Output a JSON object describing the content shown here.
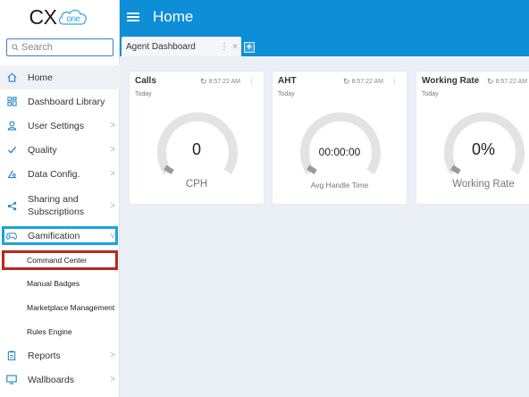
{
  "logo": {
    "text": "CX",
    "cloud_text": "one"
  },
  "search": {
    "placeholder": "Search"
  },
  "nav": {
    "home": "Home",
    "dashboard_library": "Dashboard Library",
    "user_settings": "User Settings",
    "quality": "Quality",
    "data_config": "Data Config.",
    "sharing": "Sharing and Subscriptions",
    "gamification": "Gamification",
    "sub": [
      "Command Center",
      "Manual Badges",
      "Marketplace Management",
      "Rules Engine"
    ],
    "reports": "Reports",
    "wallboards": "Wallboards",
    "chevron": ">",
    "chevron_open": "v"
  },
  "header": {
    "title": "Home",
    "menu_icon": "hamburger-icon"
  },
  "tabs": [
    {
      "label": "Agent Dashboard",
      "kebab": "⋮",
      "close": "×"
    }
  ],
  "add_tab": "+",
  "cards": [
    {
      "title": "Calls",
      "time": "8:57:22 AM",
      "subtitle": "Today",
      "value": "0",
      "caption": "CPH"
    },
    {
      "title": "AHT",
      "time": "8:57:22 AM",
      "subtitle": "Today",
      "value": "00:00:00",
      "caption": "Avg Handle Time"
    },
    {
      "title": "Working Rate",
      "time": "8:57:22 AM",
      "subtitle": "Today",
      "value": "0%",
      "caption": "Working Rate"
    }
  ],
  "colors": {
    "brand_blue": "#0d8ed6",
    "highlight_blue": "#1aa3df",
    "highlight_red": "#b52a1c",
    "gauge_track": "#e3e3e3",
    "gauge_fill": "#9a9a9a"
  }
}
